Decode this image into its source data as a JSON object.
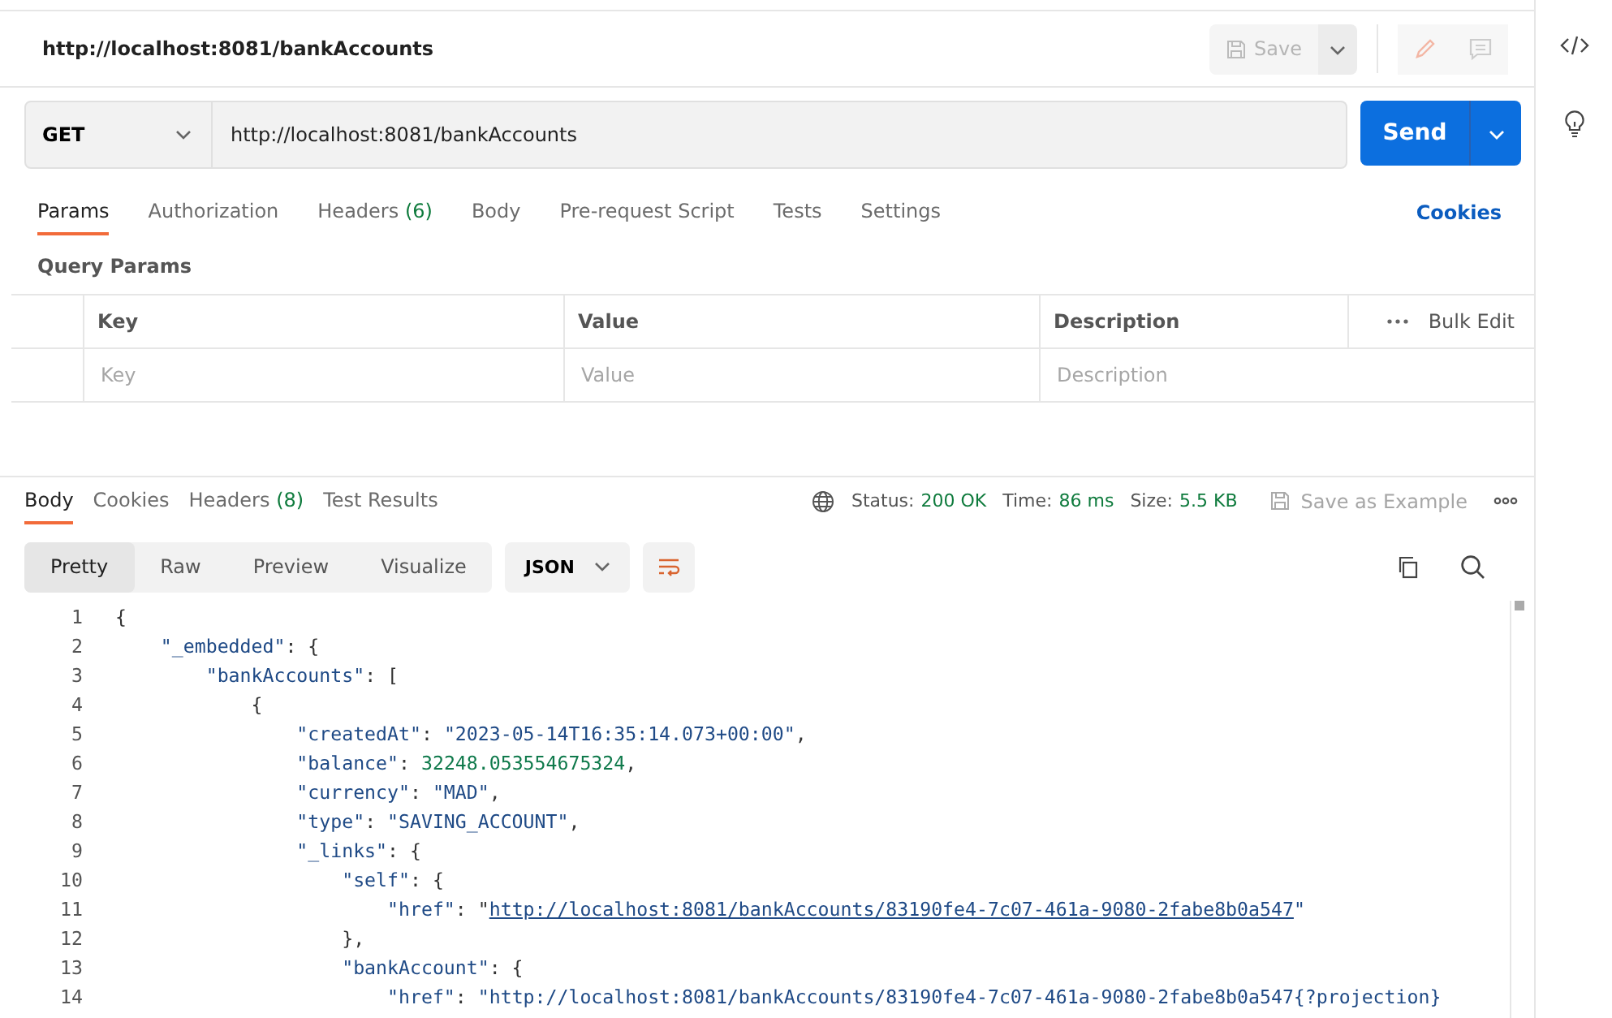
{
  "request": {
    "title": "http://localhost:8081/bankAccounts",
    "save_label": "Save",
    "method": "GET",
    "url": "http://localhost:8081/bankAccounts",
    "send_label": "Send"
  },
  "request_tabs": [
    {
      "label": "Params",
      "selected": true
    },
    {
      "label": "Authorization",
      "selected": false
    },
    {
      "label": "Headers",
      "count": "(6)",
      "selected": false
    },
    {
      "label": "Body",
      "selected": false
    },
    {
      "label": "Pre-request Script",
      "selected": false
    },
    {
      "label": "Tests",
      "selected": false
    },
    {
      "label": "Settings",
      "selected": false
    }
  ],
  "cookies_link": "Cookies",
  "query_params": {
    "title": "Query Params",
    "columns": [
      "Key",
      "Value",
      "Description"
    ],
    "bulk_edit": "Bulk Edit",
    "placeholders": [
      "Key",
      "Value",
      "Description"
    ]
  },
  "response_tabs": [
    {
      "label": "Body",
      "selected": true
    },
    {
      "label": "Cookies",
      "selected": false
    },
    {
      "label": "Headers",
      "count": "(8)",
      "selected": false
    },
    {
      "label": "Test Results",
      "selected": false
    }
  ],
  "response_status": [
    {
      "label": "Status:",
      "value": "200 OK"
    },
    {
      "label": "Time:",
      "value": "86 ms"
    },
    {
      "label": "Size:",
      "value": "5.5 KB"
    }
  ],
  "save_example": "Save as Example",
  "view_modes": [
    {
      "label": "Pretty",
      "selected": true
    },
    {
      "label": "Raw",
      "selected": false
    },
    {
      "label": "Preview",
      "selected": false
    },
    {
      "label": "Visualize",
      "selected": false
    }
  ],
  "format": "JSON",
  "code_lines": [
    {
      "n": "1",
      "parts": [
        {
          "kind": "punct",
          "text": "{"
        }
      ]
    },
    {
      "n": "2",
      "parts": [
        {
          "kind": "key",
          "text": "    \"_embedded\""
        },
        {
          "kind": "punct",
          "text": ": {"
        }
      ]
    },
    {
      "n": "3",
      "parts": [
        {
          "kind": "key",
          "text": "        \"bankAccounts\""
        },
        {
          "kind": "punct",
          "text": ": ["
        }
      ]
    },
    {
      "n": "4",
      "parts": [
        {
          "kind": "punct",
          "text": "            {"
        }
      ]
    },
    {
      "n": "5",
      "parts": [
        {
          "kind": "key",
          "text": "                \"createdAt\""
        },
        {
          "kind": "punct",
          "text": ": "
        },
        {
          "kind": "string",
          "text": "\"2023-05-14T16:35:14.073+00:00\""
        },
        {
          "kind": "punct",
          "text": ","
        }
      ]
    },
    {
      "n": "6",
      "parts": [
        {
          "kind": "key",
          "text": "                \"balance\""
        },
        {
          "kind": "punct",
          "text": ": "
        },
        {
          "kind": "number",
          "text": "32248.053554675324"
        },
        {
          "kind": "punct",
          "text": ","
        }
      ]
    },
    {
      "n": "7",
      "parts": [
        {
          "kind": "key",
          "text": "                \"currency\""
        },
        {
          "kind": "punct",
          "text": ": "
        },
        {
          "kind": "string",
          "text": "\"MAD\""
        },
        {
          "kind": "punct",
          "text": ","
        }
      ]
    },
    {
      "n": "8",
      "parts": [
        {
          "kind": "key",
          "text": "                \"type\""
        },
        {
          "kind": "punct",
          "text": ": "
        },
        {
          "kind": "string",
          "text": "\"SAVING_ACCOUNT\""
        },
        {
          "kind": "punct",
          "text": ","
        }
      ]
    },
    {
      "n": "9",
      "parts": [
        {
          "kind": "key",
          "text": "                \"_links\""
        },
        {
          "kind": "punct",
          "text": ": {"
        }
      ]
    },
    {
      "n": "10",
      "parts": [
        {
          "kind": "key",
          "text": "                    \"self\""
        },
        {
          "kind": "punct",
          "text": ": {"
        }
      ]
    },
    {
      "n": "11",
      "parts": [
        {
          "kind": "key",
          "text": "                        \"href\""
        },
        {
          "kind": "punct",
          "text": ": \""
        },
        {
          "kind": "link",
          "text": "http://localhost:8081/bankAccounts/83190fe4-7c07-461a-9080-2fabe8b0a547"
        },
        {
          "kind": "string",
          "text": "\""
        }
      ]
    },
    {
      "n": "12",
      "parts": [
        {
          "kind": "punct",
          "text": "                    },"
        }
      ]
    },
    {
      "n": "13",
      "parts": [
        {
          "kind": "key",
          "text": "                    \"bankAccount\""
        },
        {
          "kind": "punct",
          "text": ": {"
        }
      ]
    },
    {
      "n": "14",
      "parts": [
        {
          "kind": "key",
          "text": "                        \"href\""
        },
        {
          "kind": "punct",
          "text": ": "
        },
        {
          "kind": "string",
          "text": "\"http://localhost:8081/bankAccounts/83190fe4-7c07-461a-9080-2fabe8b0a547{?projection}"
        }
      ]
    }
  ]
}
